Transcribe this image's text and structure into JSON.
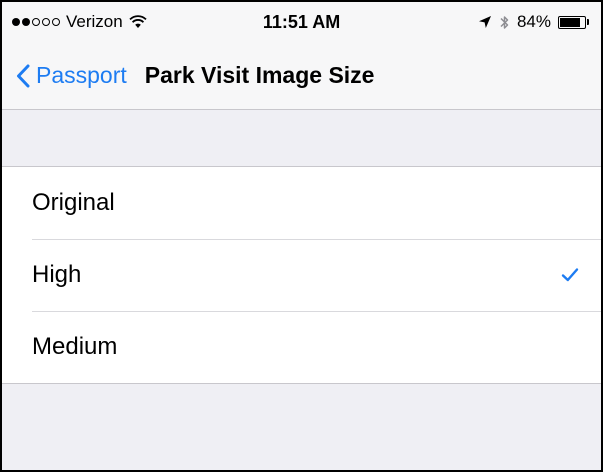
{
  "status_bar": {
    "carrier": "Verizon",
    "time": "11:51 AM",
    "battery_percent": "84%",
    "battery_level": 0.84,
    "signal_bars_filled": 2,
    "signal_bars_total": 5
  },
  "nav": {
    "back_label": "Passport",
    "title": "Park Visit Image Size"
  },
  "options": [
    {
      "label": "Original",
      "selected": false
    },
    {
      "label": "High",
      "selected": true
    },
    {
      "label": "Medium",
      "selected": false
    }
  ],
  "colors": {
    "accent": "#1d7cf2",
    "background": "#efeff4",
    "bar": "#f7f7f8"
  },
  "icons": {
    "back": "chevron-left-icon",
    "check": "checkmark-icon",
    "wifi": "wifi-icon",
    "location": "location-arrow-icon",
    "bluetooth": "bluetooth-icon",
    "battery": "battery-icon"
  }
}
